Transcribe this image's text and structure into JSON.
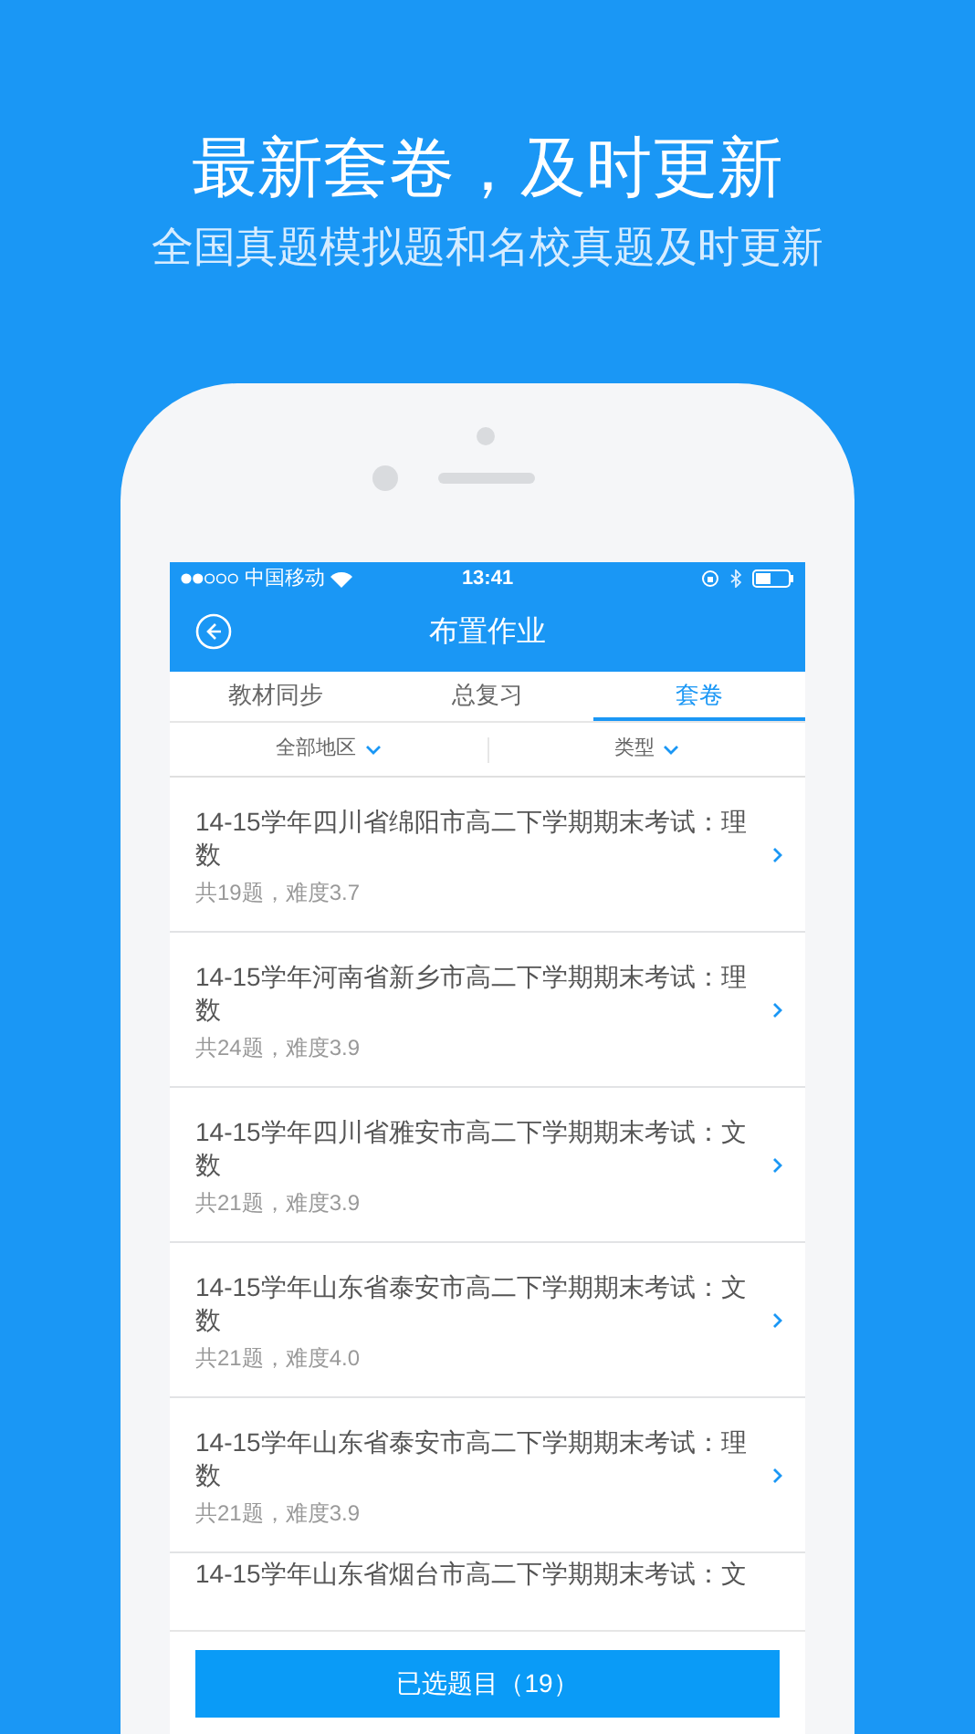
{
  "headline": "最新套卷，及时更新",
  "subheading": "全国真题模拟题和名校真题及时更新",
  "status_bar": {
    "carrier": "中国移动",
    "time": "13:41"
  },
  "nav": {
    "title": "布置作业"
  },
  "tabs": [
    {
      "label": "教材同步",
      "selected": false
    },
    {
      "label": "总复习",
      "selected": false
    },
    {
      "label": "套卷",
      "selected": true
    }
  ],
  "filters": [
    {
      "label": "全部地区"
    },
    {
      "label": "类型"
    }
  ],
  "papers": [
    {
      "title": "14-15学年四川省绵阳市高二下学期期末考试：理数",
      "meta": "共19题，难度3.7"
    },
    {
      "title": "14-15学年河南省新乡市高二下学期期末考试：理数",
      "meta": "共24题，难度3.9"
    },
    {
      "title": "14-15学年四川省雅安市高二下学期期末考试：文数",
      "meta": "共21题，难度3.9"
    },
    {
      "title": "14-15学年山东省泰安市高二下学期期末考试：文数",
      "meta": "共21题，难度4.0"
    },
    {
      "title": "14-15学年山东省泰安市高二下学期期末考试：理数",
      "meta": "共21题，难度3.9"
    },
    {
      "title": "14-15学年山东省烟台市高二下学期期末考试：文"
    }
  ],
  "footer_button": "已选题目（19）"
}
